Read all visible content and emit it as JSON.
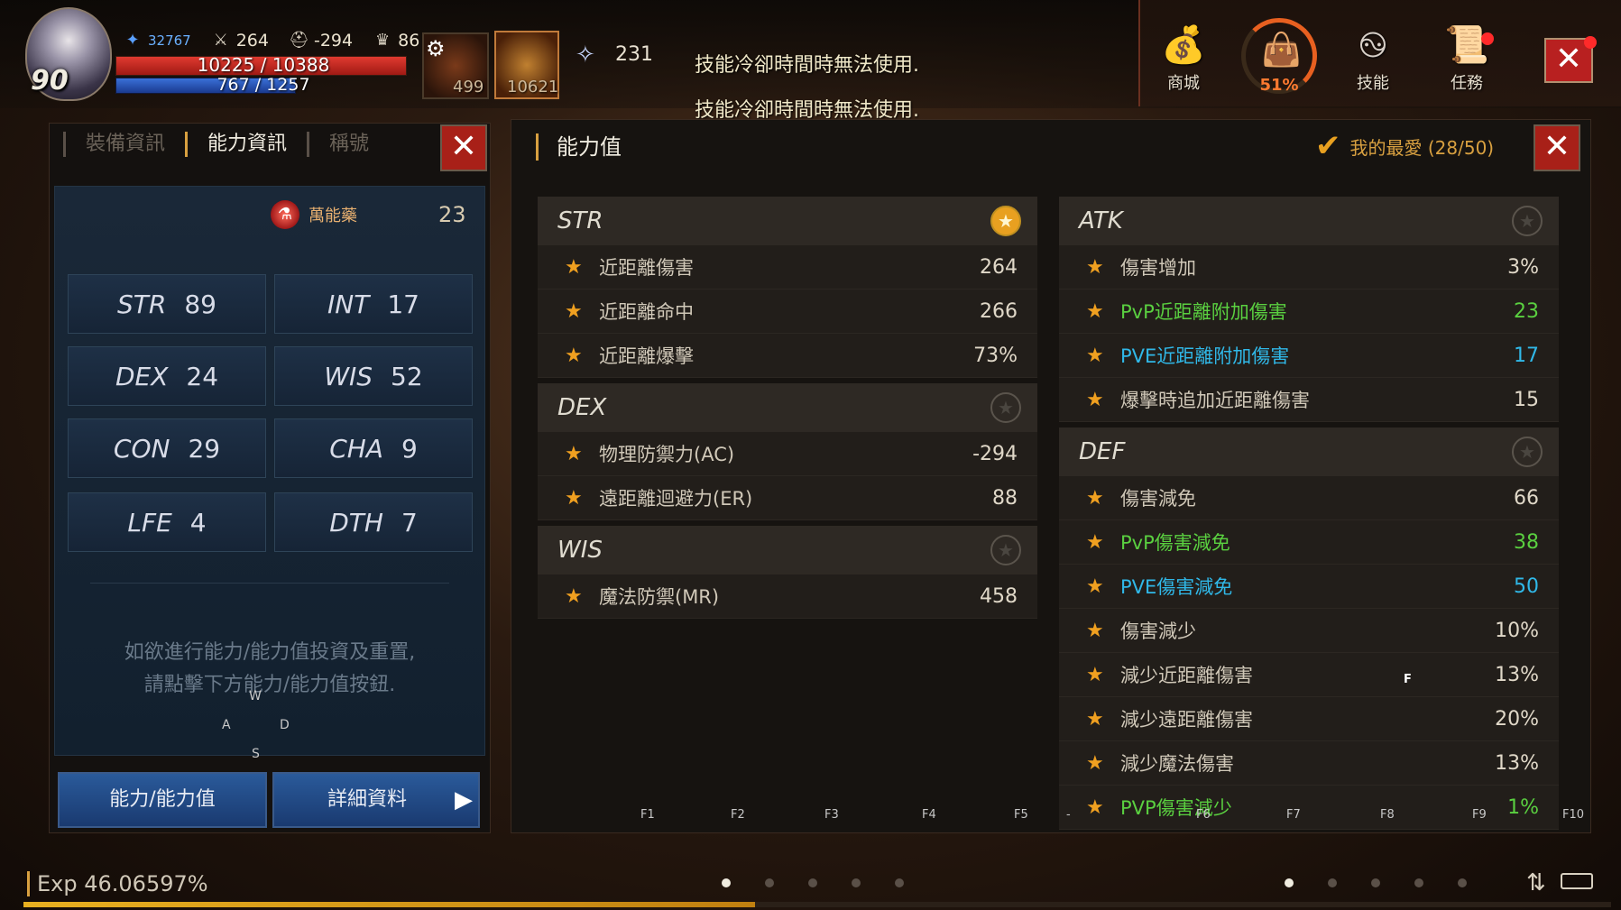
{
  "player": {
    "level": "90",
    "power": "32767",
    "attack": "264",
    "defense": "-294",
    "trophy": "86",
    "hp_text": "10225 / 10388",
    "mp_text": "767 / 1257",
    "hp_fraction": 0.984,
    "mp_fraction": 0.61
  },
  "quickslots": {
    "potion_count": "499",
    "item_count": "10621",
    "feather_count": "231"
  },
  "messages": [
    "技能冷卻時間時無法使用.",
    "技能冷卻時間時無法使用."
  ],
  "top_menu": {
    "shop_label": "商城",
    "bag_percent": "51%",
    "bag_fraction": 0.51,
    "skill_label": "技能",
    "quest_label": "任務"
  },
  "left_panel": {
    "tabs": [
      "裝備資訊",
      "能力資訊",
      "稱號"
    ],
    "active_tab": 1,
    "potion_label": "萬能藥",
    "potion_value": "23",
    "stats": [
      {
        "key": "STR",
        "value": "89"
      },
      {
        "key": "INT",
        "value": "17"
      },
      {
        "key": "DEX",
        "value": "24"
      },
      {
        "key": "WIS",
        "value": "52"
      },
      {
        "key": "CON",
        "value": "29"
      },
      {
        "key": "CHA",
        "value": "9"
      },
      {
        "key": "LFE",
        "value": "4"
      },
      {
        "key": "DTH",
        "value": "7"
      }
    ],
    "hint_line1": "如欲進行能力/能力值投資及重置,",
    "hint_line2": "請點擊下方能力/能力值按鈕.",
    "joystick": {
      "up": "W",
      "left": "A",
      "right": "D",
      "down": "S"
    },
    "btn_ability": "能力/能力值",
    "btn_detail": "詳細資料"
  },
  "right_panel": {
    "title": "能力值",
    "favorites": "我的最愛 (28/50)",
    "sections_left": [
      {
        "name": "STR",
        "fav": true,
        "rows": [
          {
            "name": "近距離傷害",
            "value": "264",
            "color": ""
          },
          {
            "name": "近距離命中",
            "value": "266",
            "color": ""
          },
          {
            "name": "近距離爆擊",
            "value": "73%",
            "color": ""
          }
        ]
      },
      {
        "name": "DEX",
        "fav": false,
        "rows": [
          {
            "name": "物理防禦力(AC)",
            "value": "-294",
            "color": ""
          },
          {
            "name": "遠距離迴避力(ER)",
            "value": "88",
            "color": ""
          }
        ]
      },
      {
        "name": "WIS",
        "fav": false,
        "rows": [
          {
            "name": "魔法防禦(MR)",
            "value": "458",
            "color": ""
          }
        ]
      }
    ],
    "sections_right": [
      {
        "name": "ATK",
        "fav": false,
        "rows": [
          {
            "name": "傷害增加",
            "value": "3%",
            "color": ""
          },
          {
            "name": "PvP近距離附加傷害",
            "value": "23",
            "color": "green"
          },
          {
            "name": "PVE近距離附加傷害",
            "value": "17",
            "color": "cyan"
          },
          {
            "name": "爆擊時追加近距離傷害",
            "value": "15",
            "color": ""
          }
        ]
      },
      {
        "name": "DEF",
        "fav": false,
        "rows": [
          {
            "name": "傷害減免",
            "value": "66",
            "color": ""
          },
          {
            "name": "PvP傷害減免",
            "value": "38",
            "color": "green"
          },
          {
            "name": "PVE傷害減免",
            "value": "50",
            "color": "cyan"
          },
          {
            "name": "傷害減少",
            "value": "10%",
            "color": ""
          },
          {
            "name": "減少近距離傷害",
            "value": "13%",
            "color": ""
          },
          {
            "name": "減少遠距離傷害",
            "value": "20%",
            "color": ""
          },
          {
            "name": "減少魔法傷害",
            "value": "13%",
            "color": ""
          },
          {
            "name": "PVP傷害減少",
            "value": "1%",
            "color": "green"
          }
        ]
      }
    ],
    "fkeys": [
      "F1",
      "F2",
      "F3",
      "F4",
      "F5",
      "-",
      "F6",
      "F7",
      "F8",
      "F9",
      "F10"
    ],
    "overlay_key": "F"
  },
  "exp": {
    "text": "Exp 46.06597%",
    "fraction": 0.4607
  },
  "colors": {
    "star": "#f0a020",
    "pvp": "#5ad040",
    "pve": "#30b8e8",
    "close_red": "#a82018"
  }
}
